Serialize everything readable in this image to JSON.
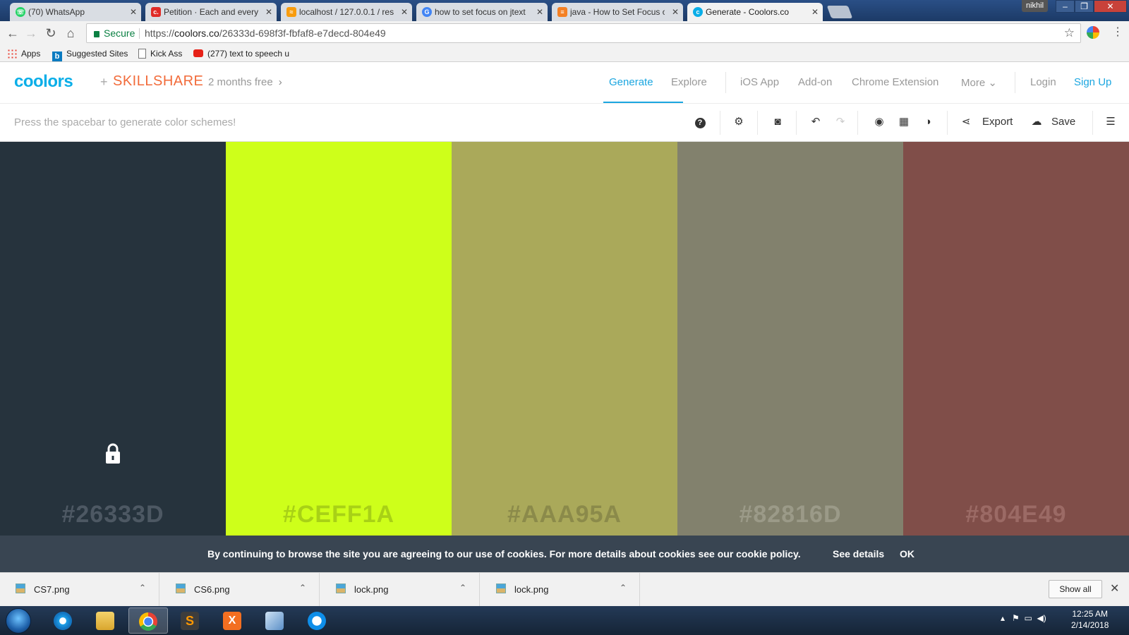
{
  "browser": {
    "tabs": [
      {
        "title": "(70) WhatsApp",
        "icon": "whatsapp-icon",
        "color": "#25d366"
      },
      {
        "title": "Petition · Each and every",
        "icon": "change-org-icon",
        "color": "#e02b27"
      },
      {
        "title": "localhost / 127.0.0.1 / res",
        "icon": "phpmyadmin-icon",
        "color": "#f89c0e"
      },
      {
        "title": "how to set focus on jtext",
        "icon": "google-icon",
        "color": "#4285f4"
      },
      {
        "title": "java - How to Set Focus o",
        "icon": "stackoverflow-icon",
        "color": "#f48024"
      },
      {
        "title": "Generate - Coolors.co",
        "icon": "coolors-icon",
        "color": "#0aaee8"
      }
    ],
    "user": "nikhil",
    "secure_label": "Secure",
    "url_scheme": "https://",
    "url_host": "coolors.co",
    "url_path": "/26333d-698f3f-fbfaf8-e7decd-804e49",
    "bookmarks": [
      "Apps",
      "Suggested Sites",
      "Kick Ass",
      "(277) text to speech u"
    ]
  },
  "site": {
    "logo": "coolors",
    "plus": "+",
    "partner": "SKILLSHARE",
    "promo": "2 months free",
    "nav": [
      "Generate",
      "Explore",
      "iOS App",
      "Add-on",
      "Chrome Extension",
      "More"
    ],
    "login": "Login",
    "signup": "Sign Up",
    "accent": "#1ba6e0"
  },
  "toolbar": {
    "hint": "Press the spacebar to generate color schemes!",
    "export_label": "Export",
    "save_label": "Save"
  },
  "palette": [
    {
      "hex": "#26333D",
      "color": "#26333d",
      "text_color": "#4d5863",
      "locked": true
    },
    {
      "hex": "#CEFF1A",
      "color": "#ceff1a",
      "text_color": "#a8d116",
      "locked": false
    },
    {
      "hex": "#AAA95A",
      "color": "#aaa95a",
      "text_color": "#8b8a4a",
      "locked": false
    },
    {
      "hex": "#82816D",
      "color": "#82816d",
      "text_color": "#9b9a88",
      "locked": false
    },
    {
      "hex": "#804E49",
      "color": "#804e49",
      "text_color": "#9b6a65",
      "locked": false
    }
  ],
  "cookie": {
    "message": "By continuing to browse the site you are agreeing to our use of cookies. For more details about cookies see our cookie policy.",
    "details": "See details",
    "ok": "OK"
  },
  "downloads": {
    "files": [
      "CS7.png",
      "CS6.png",
      "lock.png",
      "lock.png"
    ],
    "show_all": "Show all"
  },
  "taskbar": {
    "time": "12:25 AM",
    "date": "2/14/2018",
    "apps": [
      "internet-explorer-icon",
      "file-explorer-icon",
      "chrome-icon",
      "sublime-text-icon",
      "xampp-icon",
      "virtualbox-icon",
      "teamviewer-icon"
    ]
  }
}
